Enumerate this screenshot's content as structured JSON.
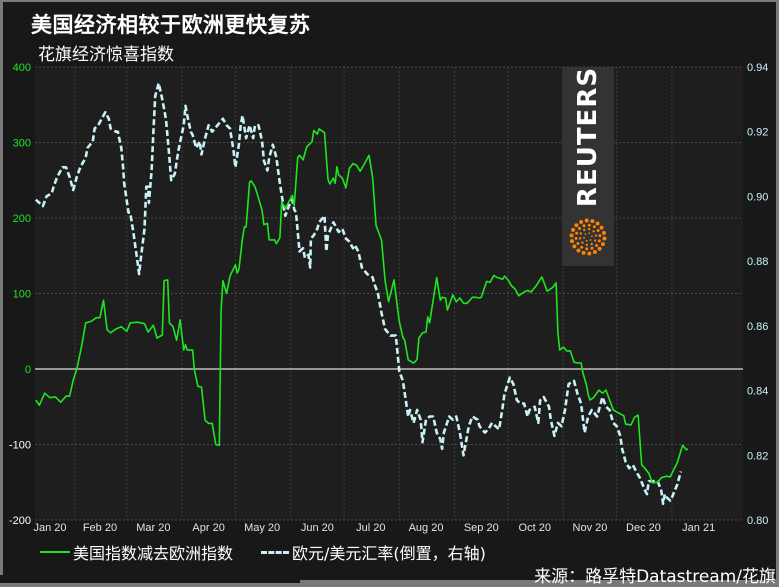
{
  "title": "美国经济相较于欧洲更快复苏",
  "subtitle": "花旗经济惊喜指数",
  "legend": {
    "series1": "美国指数减去欧洲指数",
    "series2": "欧元/美元汇率(倒置，右轴)"
  },
  "source": "来源：路孚特Datastream/花旗",
  "logo": {
    "text": "REUTERS",
    "accent": "#ff8200"
  },
  "colors": {
    "series1": "#1ee61e",
    "series2": "#c8f2f6",
    "left_ticks_pos": "#1ee61e",
    "left_ticks_neg": "#ffffff",
    "right_ticks": "#c8f2f6",
    "zero_line": "#bdbdbd"
  },
  "chart_data": {
    "type": "line",
    "title": "美国经济相较于欧洲更快复苏",
    "subtitle": "花旗经济惊喜指数",
    "xlabel": "",
    "ylabel": "",
    "y2label": "",
    "x_units": "days since 2020-01-01",
    "xlim": [
      8,
      406
    ],
    "ylim": [
      -200,
      400
    ],
    "y2lim": [
      0.8,
      0.94
    ],
    "grid": true,
    "legend_position": "bottom-left",
    "x_ticks": [
      {
        "label": "Jan 20",
        "day": 17
      },
      {
        "label": "Feb 20",
        "day": 45
      },
      {
        "label": "Mar 20",
        "day": 75
      },
      {
        "label": "Apr 20",
        "day": 106
      },
      {
        "label": "May 20",
        "day": 136
      },
      {
        "label": "Jun 20",
        "day": 167
      },
      {
        "label": "Jul 20",
        "day": 197
      },
      {
        "label": "Aug 20",
        "day": 228
      },
      {
        "label": "Sep 20",
        "day": 259
      },
      {
        "label": "Oct 20",
        "day": 289
      },
      {
        "label": "Nov 20",
        "day": 320
      },
      {
        "label": "Dec 20",
        "day": 350
      },
      {
        "label": "Jan 21",
        "day": 381
      }
    ],
    "x_gridlines": [
      31,
      60,
      91,
      121,
      152,
      182,
      213,
      244,
      274,
      305,
      335,
      366
    ],
    "y_ticks": [
      400,
      300,
      200,
      100,
      0,
      -100,
      -200
    ],
    "y2_ticks": [
      0.94,
      0.92,
      0.9,
      0.88,
      0.86,
      0.84,
      0.82,
      0.8
    ],
    "series": [
      {
        "name": "美国指数减去欧洲指数",
        "axis": "left",
        "style": "solid",
        "x": [
          9,
          11,
          14,
          17,
          20,
          23,
          26,
          28,
          30,
          32,
          34,
          35,
          37,
          40,
          43,
          45,
          47,
          49,
          51,
          54,
          57,
          60,
          62,
          66,
          70,
          72,
          75,
          77,
          80,
          81,
          83,
          84,
          86,
          88,
          90,
          92,
          93,
          94,
          97,
          98,
          100,
          102,
          104,
          106,
          108,
          110,
          112,
          113,
          114,
          116,
          118,
          121,
          122,
          123,
          125,
          126,
          127,
          129,
          130,
          132,
          133,
          136,
          137,
          139,
          140,
          143,
          144,
          146,
          147,
          149,
          153,
          154,
          156,
          157,
          159,
          161,
          164,
          165,
          167,
          168,
          171,
          173,
          174,
          176,
          177,
          178,
          179,
          181,
          183,
          185,
          187,
          189,
          191,
          193,
          196,
          198,
          200,
          203,
          205,
          207,
          210,
          212,
          213,
          215,
          216,
          218,
          221,
          222,
          223,
          224,
          226,
          228,
          229,
          230,
          234,
          236,
          237,
          239,
          240,
          243,
          245,
          247,
          249,
          251,
          254,
          256,
          258,
          259,
          262,
          264,
          266,
          268,
          271,
          272,
          274,
          276,
          278,
          280,
          283,
          285,
          287,
          290,
          293,
          296,
          299,
          301,
          302,
          303,
          305,
          307,
          309,
          311,
          313,
          315,
          316,
          318,
          319,
          320,
          322,
          325,
          327,
          329,
          331,
          333,
          335,
          339,
          340,
          343,
          345,
          347,
          349,
          351,
          353,
          355,
          358,
          360,
          363,
          365,
          366,
          369,
          370,
          372,
          374,
          375
        ],
        "values": [
          -41,
          -48,
          -32,
          -38,
          -37,
          -44,
          -36,
          -36,
          -15,
          0,
          22,
          34,
          61,
          63,
          68,
          68,
          91,
          52,
          48,
          53,
          56,
          50,
          61,
          62,
          60,
          49,
          58,
          41,
          45,
          117,
          118,
          61,
          56,
          38,
          65,
          25,
          32,
          25,
          25,
          -1,
          -23,
          -24,
          -68,
          -72,
          -72,
          -100,
          -101,
          78,
          117,
          100,
          123,
          138,
          127,
          132,
          173,
          188,
          188,
          248,
          249,
          241,
          234,
          210,
          191,
          193,
          171,
          171,
          166,
          174,
          221,
          213,
          230,
          217,
          280,
          283,
          277,
          294,
          301,
          316,
          311,
          318,
          313,
          251,
          245,
          253,
          246,
          268,
          257,
          253,
          240,
          266,
          272,
          270,
          262,
          270,
          283,
          254,
          190,
          171,
          117,
          89,
          118,
          81,
          63,
          42,
          38,
          12,
          8,
          10,
          13,
          41,
          48,
          49,
          69,
          61,
          121,
          91,
          95,
          94,
          78,
          98,
          89,
          94,
          87,
          87,
          95,
          95,
          94,
          95,
          116,
          115,
          124,
          121,
          119,
          123,
          118,
          110,
          106,
          97,
          102,
          104,
          102,
          111,
          122,
          103,
          108,
          114,
          48,
          25,
          29,
          24,
          24,
          9,
          8,
          8,
          -5,
          -21,
          -34,
          -41,
          -38,
          -28,
          -32,
          -28,
          -41,
          -54,
          -57,
          -62,
          -73,
          -74,
          -64,
          -61,
          -127,
          -132,
          -138,
          -151,
          -150,
          -144,
          -142,
          -143,
          -138,
          -124,
          -116,
          -101,
          -107,
          -106
        ]
      },
      {
        "name": "欧元/美元汇率(倒置，右轴)",
        "axis": "right",
        "style": "dashed",
        "x": [
          9,
          11,
          13,
          15,
          18,
          19,
          21,
          24,
          26,
          28,
          30,
          32,
          34,
          37,
          38,
          41,
          42,
          44,
          46,
          48,
          50,
          51,
          54,
          55,
          57,
          58,
          58.6,
          61,
          62,
          64,
          66,
          67,
          68,
          70,
          71,
          72,
          72.5,
          74,
          75,
          76,
          78,
          80,
          82,
          83,
          84,
          85,
          87,
          89,
          92,
          93,
          94,
          96,
          97,
          99,
          101,
          102,
          104,
          106,
          108,
          111,
          114,
          116,
          118,
          120,
          121,
          123,
          124,
          125,
          127,
          129,
          131,
          132,
          134,
          136,
          137,
          139,
          140,
          142,
          144,
          145,
          146,
          148,
          149,
          151,
          153,
          154,
          155,
          157,
          159,
          160,
          162,
          163,
          163.4,
          165,
          167,
          168,
          171,
          172,
          173,
          176,
          177,
          179,
          181,
          183,
          185,
          187,
          188,
          190,
          192,
          195,
          198,
          199,
          201,
          203,
          205,
          208,
          211,
          213,
          215,
          218,
          219,
          221,
          223,
          225,
          226,
          228,
          230,
          232,
          234,
          236,
          237,
          238,
          241,
          243,
          245,
          247,
          249,
          252,
          254,
          257,
          258,
          261,
          263,
          265,
          269,
          271,
          272,
          275,
          277,
          279,
          281,
          283,
          285,
          286,
          289,
          291,
          292,
          294,
          297,
          298,
          300,
          302,
          304,
          306,
          308,
          311,
          313,
          315,
          317,
          319,
          321,
          324,
          326,
          327,
          329,
          331,
          333,
          335,
          337,
          338,
          340,
          342,
          344,
          346,
          348,
          351,
          352,
          353,
          355,
          358,
          360,
          361,
          362,
          363,
          365,
          366,
          369,
          371,
          372,
          373,
          374
        ],
        "values": [
          0.899,
          0.898,
          0.897,
          0.9,
          0.901,
          0.903,
          0.906,
          0.909,
          0.909,
          0.906,
          0.902,
          0.906,
          0.909,
          0.912,
          0.915,
          0.917,
          0.921,
          0.922,
          0.924,
          0.926,
          0.924,
          0.921,
          0.92,
          0.92,
          0.915,
          0.909,
          0.904,
          0.895,
          0.895,
          0.888,
          0.88,
          0.876,
          0.881,
          0.89,
          0.903,
          0.903,
          0.898,
          0.908,
          0.92,
          0.931,
          0.935,
          0.93,
          0.924,
          0.918,
          0.912,
          0.905,
          0.907,
          0.914,
          0.922,
          0.928,
          0.925,
          0.92,
          0.919,
          0.915,
          0.917,
          0.913,
          0.918,
          0.922,
          0.92,
          0.922,
          0.924,
          0.922,
          0.921,
          0.914,
          0.909,
          0.916,
          0.922,
          0.925,
          0.918,
          0.922,
          0.918,
          0.922,
          0.922,
          0.917,
          0.911,
          0.908,
          0.912,
          0.916,
          0.912,
          0.908,
          0.904,
          0.897,
          0.894,
          0.897,
          0.899,
          0.896,
          0.895,
          0.883,
          0.884,
          0.881,
          0.882,
          0.878,
          0.887,
          0.888,
          0.89,
          0.892,
          0.894,
          0.883,
          0.888,
          0.892,
          0.891,
          0.889,
          0.89,
          0.887,
          0.886,
          0.884,
          0.885,
          0.883,
          0.878,
          0.876,
          0.875,
          0.873,
          0.87,
          0.864,
          0.859,
          0.857,
          0.857,
          0.846,
          0.843,
          0.832,
          0.834,
          0.83,
          0.834,
          0.831,
          0.824,
          0.831,
          0.832,
          0.832,
          0.827,
          0.825,
          0.822,
          0.827,
          0.832,
          0.831,
          0.832,
          0.827,
          0.82,
          0.829,
          0.832,
          0.831,
          0.829,
          0.827,
          0.828,
          0.83,
          0.828,
          0.835,
          0.839,
          0.844,
          0.842,
          0.837,
          0.836,
          0.836,
          0.832,
          0.834,
          0.835,
          0.83,
          0.837,
          0.838,
          0.835,
          0.831,
          0.826,
          0.83,
          0.829,
          0.834,
          0.842,
          0.843,
          0.839,
          0.836,
          0.827,
          0.832,
          0.834,
          0.832,
          0.836,
          0.838,
          0.835,
          0.834,
          0.83,
          0.829,
          0.826,
          0.822,
          0.818,
          0.816,
          0.817,
          0.815,
          0.813,
          0.809,
          0.808,
          0.812,
          0.812,
          0.812,
          0.809,
          0.805,
          0.808,
          0.807,
          0.806,
          0.807,
          0.811,
          0.815
        ]
      }
    ]
  }
}
